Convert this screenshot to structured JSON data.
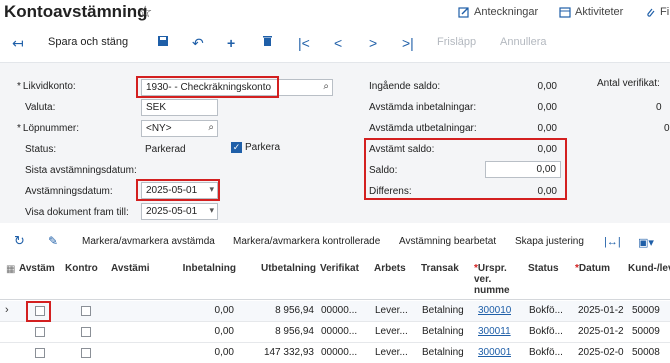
{
  "header": {
    "title": "Kontoavstämning",
    "links": {
      "notes": "Anteckningar",
      "activities": "Aktiviteter",
      "files": "Fi"
    }
  },
  "toolbar": {
    "save_close": "Spara och stäng",
    "release": "Frisläpp",
    "cancel": "Annullera"
  },
  "form": {
    "ledger_account": {
      "label": "Likvidkonto:",
      "value": "1930- - Checkräkningskonto"
    },
    "currency": {
      "label": "Valuta:",
      "value": "SEK"
    },
    "ref_number": {
      "label": "Löpnummer:",
      "value": "<NY>"
    },
    "status": {
      "label": "Status:",
      "value": "Parkerad"
    },
    "hold": {
      "label": "Parkera",
      "checked": true
    },
    "last_recon_date": {
      "label": "Sista avstämningsdatum:"
    },
    "recon_date": {
      "label": "Avstämningsdatum:",
      "value": "2025-05-01"
    },
    "show_docs_until": {
      "label": "Visa dokument fram till:",
      "value": "2025-05-01"
    },
    "opening_balance": {
      "label": "Ingående saldo:",
      "value": "0,00"
    },
    "reconciled_receipts": {
      "label": "Avstämda inbetalningar:",
      "value": "0,00"
    },
    "reconciled_disbursements": {
      "label": "Avstämda utbetalningar:",
      "value": "0,00"
    },
    "reconciled_balance": {
      "label": "Avstämt saldo:",
      "value": "0,00"
    },
    "balance": {
      "label": "Saldo:",
      "value": "0,00"
    },
    "difference": {
      "label": "Differens:",
      "value": "0,00"
    },
    "txn_count": {
      "label": "Antal verifikat:",
      "value1": "0",
      "value2": "0"
    }
  },
  "grid_toolbar": {
    "mark_reconciled": "Markera/avmarkera avstämda",
    "mark_verified": "Markera/avmarkera kontrollerade",
    "process_recon": "Avstämning bearbetat",
    "create_adjustment": "Skapa justering"
  },
  "table": {
    "columns": [
      "Avstäm",
      "Kontro",
      "Avstämi",
      "Inbetalning",
      "Utbetalning",
      "Verifikat",
      "Arbets",
      "Transak",
      "Urspr. ver. numme",
      "Status",
      "Datum",
      "Kund-/lev"
    ],
    "rows": [
      {
        "receipt": "0,00",
        "disbursement": "8 956,94",
        "voucher": "00000...",
        "module": "Lever...",
        "type": "Betalning",
        "orig_ref": "300010",
        "status": "Bokfö...",
        "date": "2025-01-2",
        "vendor": "50009"
      },
      {
        "receipt": "0,00",
        "disbursement": "8 956,94",
        "voucher": "00000...",
        "module": "Lever...",
        "type": "Betalning",
        "orig_ref": "300011",
        "status": "Bokfö...",
        "date": "2025-01-2",
        "vendor": "50009"
      },
      {
        "receipt": "0,00",
        "disbursement": "147 332,93",
        "voucher": "00000...",
        "module": "Lever...",
        "type": "Betalning",
        "orig_ref": "300001",
        "status": "Bokfö...",
        "date": "2025-02-0",
        "vendor": "50008"
      }
    ]
  },
  "colors": {
    "accent": "#1f5fa8",
    "highlight": "#d32020"
  }
}
